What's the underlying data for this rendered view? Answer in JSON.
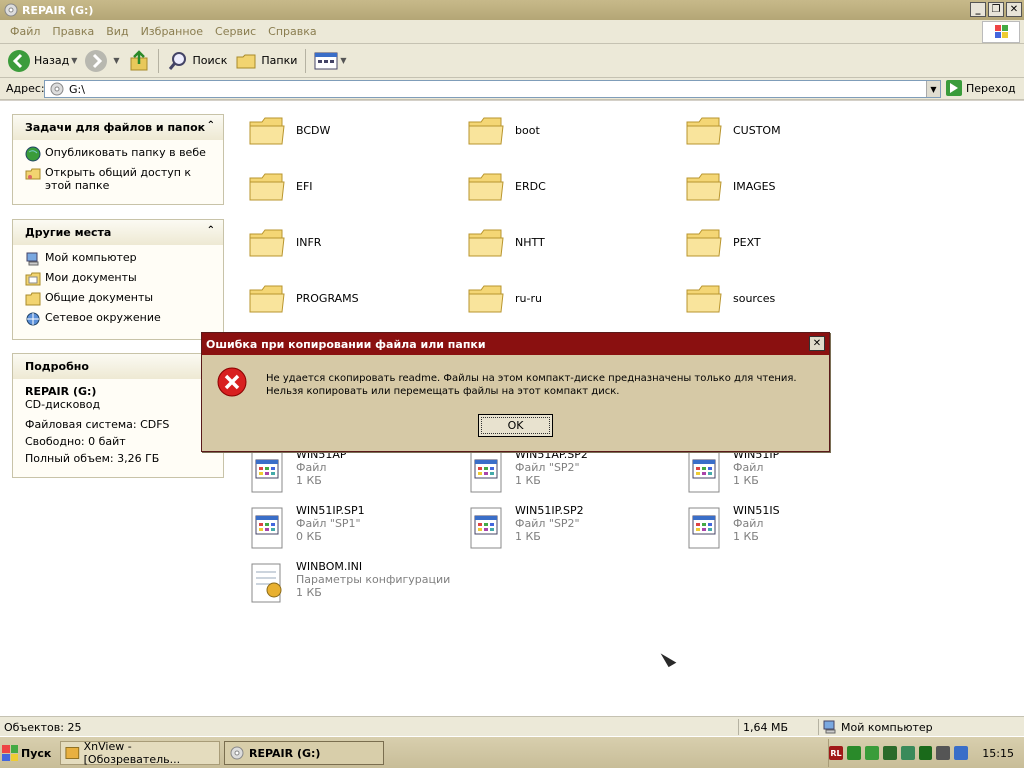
{
  "window": {
    "title": "REPAIR (G:)"
  },
  "menu": [
    "Файл",
    "Правка",
    "Вид",
    "Избранное",
    "Сервис",
    "Справка"
  ],
  "toolbar": {
    "back": "Назад",
    "search": "Поиск",
    "folders": "Папки"
  },
  "address": {
    "label": "Адрес:",
    "value": "G:\\",
    "go": "Переход"
  },
  "left_panels": {
    "tasks": {
      "title": "Задачи для файлов и папок",
      "items": [
        "Опубликовать папку в вебе",
        "Открыть общий доступ к этой папке"
      ]
    },
    "places": {
      "title": "Другие места",
      "items": [
        "Мой компьютер",
        "Мои документы",
        "Общие документы",
        "Сетевое окружение"
      ]
    },
    "details": {
      "title": "Подробно",
      "name": "REPAIR (G:)",
      "type": "CD-дисковод",
      "fs": "Файловая система: CDFS",
      "free": "Свободно: 0 байт",
      "total": "Полный объем: 3,26 ГБ"
    }
  },
  "folders": [
    "BCDW",
    "boot",
    "CUSTOM",
    "EFI",
    "ERDC",
    "IMAGES",
    "INFR",
    "NHTT",
    "PEXT",
    "PROGRAMS",
    "ru-ru",
    "sources"
  ],
  "files": [
    {
      "name": "WIN51AP",
      "type": "Файл",
      "size": "1 КБ"
    },
    {
      "name": "WIN51AP.SP2",
      "type": "Файл \"SP2\"",
      "size": "1 КБ"
    },
    {
      "name": "WIN51IP",
      "type": "Файл",
      "size": "1 КБ"
    },
    {
      "name": "WIN51IP.SP1",
      "type": "Файл \"SP1\"",
      "size": "0 КБ"
    },
    {
      "name": "WIN51IP.SP2",
      "type": "Файл \"SP2\"",
      "size": "1 КБ"
    },
    {
      "name": "WIN51IS",
      "type": "Файл",
      "size": "1 КБ"
    },
    {
      "name": "WINBOM.INI",
      "type": "Параметры конфигурации",
      "size": "1 КБ"
    }
  ],
  "dialog": {
    "title": "Ошибка при копировании файла или папки",
    "message": "Не удается скопировать readme. Файлы на этом компакт-диске предназначены только для чтения. Нельзя копировать или перемещать файлы на этот компакт диск.",
    "ok": "OK"
  },
  "status": {
    "objects": "Объектов: 25",
    "size": "1,64 МБ",
    "location": "Мой компьютер"
  },
  "taskbar": {
    "start": "Пуск",
    "tasks": [
      "XnView - [Обозреватель...",
      "REPAIR (G:)"
    ],
    "tray_label": "RL",
    "clock": "15:15"
  },
  "colors": {
    "dialog_title": "#8a1010",
    "link": "#000000",
    "menu_text": "#8a7d4f"
  }
}
